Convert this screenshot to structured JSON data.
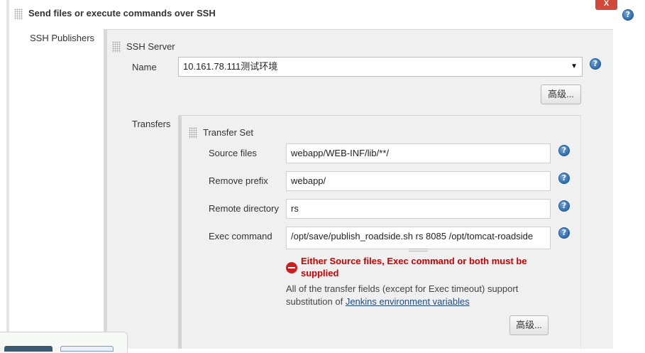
{
  "header": {
    "title": "Send files or execute commands over SSH",
    "close_label": "X",
    "help_symbol": "?"
  },
  "ssh_publishers_label": "SSH Publishers",
  "ssh_server": {
    "heading": "SSH Server",
    "name_label": "Name",
    "name_value": "10.161.78.111测试环境",
    "advanced_button": "高级..."
  },
  "transfers": {
    "label": "Transfers",
    "set_heading": "Transfer Set",
    "source_files_label": "Source files",
    "source_files_value": "webapp/WEB-INF/lib/**/",
    "remove_prefix_label": "Remove prefix",
    "remove_prefix_value": "webapp/",
    "remote_directory_label": "Remote directory",
    "remote_directory_value": "rs",
    "exec_command_label": "Exec command",
    "exec_command_value": "/opt/save/publish_roadside.sh rs 8085 /opt/tomcat-roadside",
    "error_line1": "Either Source files, Exec command or both must be",
    "error_line2": "supplied",
    "info_line1": "All of the transfer fields (except for Exec timeout) support",
    "info_line2_prefix": "substitution of ",
    "info_link": "Jenkins environment variables",
    "advanced_button": "高级..."
  },
  "colors": {
    "panel_bg": "#f0f0f0",
    "error_red": "#cc0000",
    "close_red": "#d24939",
    "link": "#204a87"
  }
}
